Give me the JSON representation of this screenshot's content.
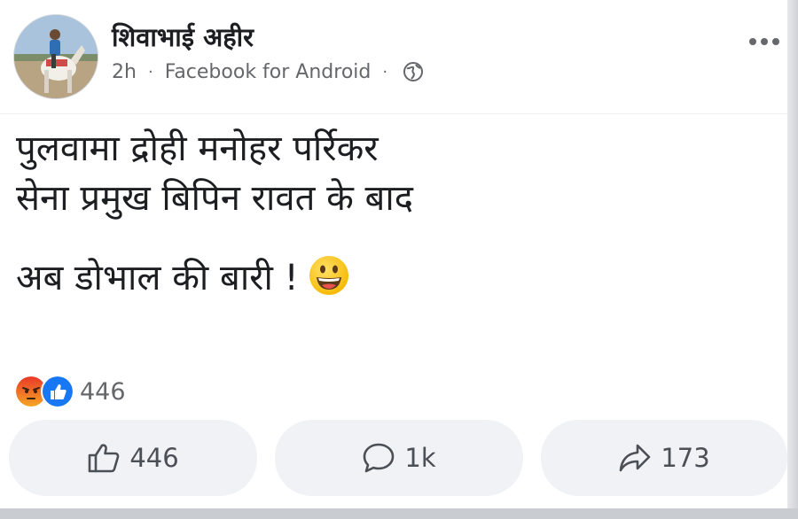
{
  "post": {
    "author": "शिवाभाई अहीर",
    "time": "2h",
    "source": "Facebook for Android",
    "separator": "·",
    "privacy_icon": "globe-icon",
    "text_lines": [
      "पुलवामा द्रोही मनोहर पर्रिकर",
      "सेना प्रमुख बिपिन रावत के बाद"
    ],
    "text_last_line": "अब डोभाल की बारी !",
    "emoji": "grinning-face"
  },
  "reactions": {
    "icons": [
      "angry-reaction-icon",
      "like-reaction-icon"
    ],
    "count": "446"
  },
  "actions": {
    "like_count": "446",
    "comment_count": "1k",
    "share_count": "173"
  },
  "colors": {
    "text": "#1c1e21",
    "secondary_text": "#65676b",
    "button_bg": "#f0f2f5",
    "like_blue": "#1877f2",
    "angry_orange": "#f05d22"
  }
}
